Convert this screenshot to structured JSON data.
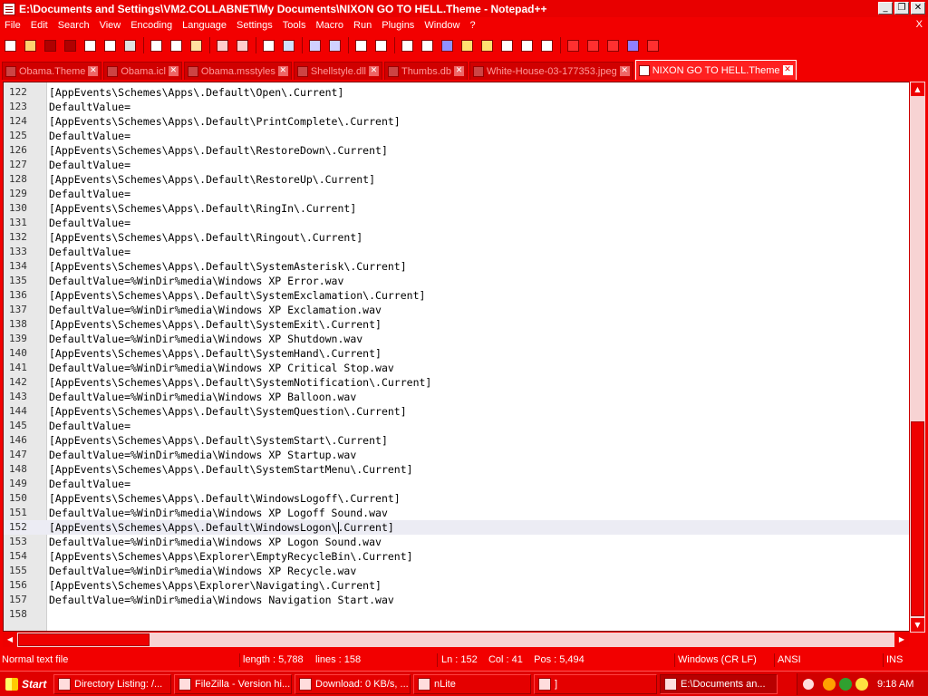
{
  "window": {
    "title": "E:\\Documents and Settings\\VM2.COLLABNET\\My Documents\\NIXON GO TO HELL.Theme - Notepad++",
    "min_glyph": "_",
    "max_glyph": "❐",
    "close_glyph": "✕"
  },
  "menu": {
    "items": [
      "File",
      "Edit",
      "Search",
      "View",
      "Encoding",
      "Language",
      "Settings",
      "Tools",
      "Macro",
      "Run",
      "Plugins",
      "Window",
      "?"
    ],
    "close_glyph": "X"
  },
  "toolbar": {
    "buttons": [
      {
        "icon": "new-file-icon",
        "color": "#ffffff"
      },
      {
        "icon": "open-file-icon",
        "color": "#ffd070"
      },
      {
        "icon": "save-icon",
        "color": "#b00000"
      },
      {
        "icon": "save-all-icon",
        "color": "#b00000"
      },
      {
        "icon": "close-file-icon",
        "color": "#ffffff"
      },
      {
        "icon": "close-all-icon",
        "color": "#ffffff"
      },
      {
        "icon": "print-icon",
        "color": "#e0e0e0"
      },
      {
        "icon": "sep",
        "color": ""
      },
      {
        "icon": "cut-icon",
        "color": "#ffffff"
      },
      {
        "icon": "copy-icon",
        "color": "#ffffff"
      },
      {
        "icon": "paste-icon",
        "color": "#ffe0a0"
      },
      {
        "icon": "sep",
        "color": ""
      },
      {
        "icon": "undo-icon",
        "color": "#ffcccc"
      },
      {
        "icon": "redo-icon",
        "color": "#ffcccc"
      },
      {
        "icon": "sep",
        "color": ""
      },
      {
        "icon": "find-icon",
        "color": "#ffffff"
      },
      {
        "icon": "replace-icon",
        "color": "#d0e0ff"
      },
      {
        "icon": "sep",
        "color": ""
      },
      {
        "icon": "zoom-in-icon",
        "color": "#d0d0ff"
      },
      {
        "icon": "zoom-out-icon",
        "color": "#d0d0ff"
      },
      {
        "icon": "sep",
        "color": ""
      },
      {
        "icon": "sync-vertical-icon",
        "color": "#ffffff"
      },
      {
        "icon": "sync-horizontal-icon",
        "color": "#ffffff"
      },
      {
        "icon": "sep",
        "color": ""
      },
      {
        "icon": "word-wrap-icon",
        "color": "#ffffff"
      },
      {
        "icon": "show-all-chars-icon",
        "color": "#ffffff"
      },
      {
        "icon": "indent-guide-icon",
        "color": "#9090ff"
      },
      {
        "icon": "user-lang-icon",
        "color": "#ffe070"
      },
      {
        "icon": "doc-map-icon",
        "color": "#ffe070"
      },
      {
        "icon": "function-list-icon",
        "color": "#ffffff"
      },
      {
        "icon": "folder-workspace-icon",
        "color": "#ffffff"
      },
      {
        "icon": "monitoring-icon",
        "color": "#ffffff"
      },
      {
        "icon": "sep",
        "color": ""
      },
      {
        "icon": "record-macro-icon",
        "color": "#ff3030"
      },
      {
        "icon": "stop-record-icon",
        "color": "#ff3030"
      },
      {
        "icon": "play-macro-icon",
        "color": "#ff3030"
      },
      {
        "icon": "run-macro-multiple-icon",
        "color": "#9080ff"
      },
      {
        "icon": "save-macro-icon",
        "color": "#ff3030"
      }
    ]
  },
  "tabs": [
    {
      "label": "Obama.Theme",
      "active": false
    },
    {
      "label": "Obama.icl",
      "active": false
    },
    {
      "label": "Obama.msstyles",
      "active": false
    },
    {
      "label": "Shellstyle.dll",
      "active": false
    },
    {
      "label": "Thumbs.db",
      "active": false
    },
    {
      "label": "White-House-03-177353.jpeg",
      "active": false
    },
    {
      "label": "NIXON GO TO HELL.Theme",
      "active": true
    }
  ],
  "tab_close_glyph": "✕",
  "editor": {
    "current_line": 152,
    "lines": [
      {
        "n": "122",
        "text": "[AppEvents\\Schemes\\Apps\\.Default\\Open\\.Current]"
      },
      {
        "n": "123",
        "text": "DefaultValue="
      },
      {
        "n": "124",
        "text": "[AppEvents\\Schemes\\Apps\\.Default\\PrintComplete\\.Current]"
      },
      {
        "n": "125",
        "text": "DefaultValue="
      },
      {
        "n": "126",
        "text": "[AppEvents\\Schemes\\Apps\\.Default\\RestoreDown\\.Current]"
      },
      {
        "n": "127",
        "text": "DefaultValue="
      },
      {
        "n": "128",
        "text": "[AppEvents\\Schemes\\Apps\\.Default\\RestoreUp\\.Current]"
      },
      {
        "n": "129",
        "text": "DefaultValue="
      },
      {
        "n": "130",
        "text": "[AppEvents\\Schemes\\Apps\\.Default\\RingIn\\.Current]"
      },
      {
        "n": "131",
        "text": "DefaultValue="
      },
      {
        "n": "132",
        "text": "[AppEvents\\Schemes\\Apps\\.Default\\Ringout\\.Current]"
      },
      {
        "n": "133",
        "text": "DefaultValue="
      },
      {
        "n": "134",
        "text": "[AppEvents\\Schemes\\Apps\\.Default\\SystemAsterisk\\.Current]"
      },
      {
        "n": "135",
        "text": "DefaultValue=%WinDir%media\\Windows XP Error.wav"
      },
      {
        "n": "136",
        "text": "[AppEvents\\Schemes\\Apps\\.Default\\SystemExclamation\\.Current]"
      },
      {
        "n": "137",
        "text": "DefaultValue=%WinDir%media\\Windows XP Exclamation.wav"
      },
      {
        "n": "138",
        "text": "[AppEvents\\Schemes\\Apps\\.Default\\SystemExit\\.Current]"
      },
      {
        "n": "139",
        "text": "DefaultValue=%WinDir%media\\Windows XP Shutdown.wav"
      },
      {
        "n": "140",
        "text": "[AppEvents\\Schemes\\Apps\\.Default\\SystemHand\\.Current]"
      },
      {
        "n": "141",
        "text": "DefaultValue=%WinDir%media\\Windows XP Critical Stop.wav"
      },
      {
        "n": "142",
        "text": "[AppEvents\\Schemes\\Apps\\.Default\\SystemNotification\\.Current]"
      },
      {
        "n": "143",
        "text": "DefaultValue=%WinDir%media\\Windows XP Balloon.wav"
      },
      {
        "n": "144",
        "text": "[AppEvents\\Schemes\\Apps\\.Default\\SystemQuestion\\.Current]"
      },
      {
        "n": "145",
        "text": "DefaultValue="
      },
      {
        "n": "146",
        "text": "[AppEvents\\Schemes\\Apps\\.Default\\SystemStart\\.Current]"
      },
      {
        "n": "147",
        "text": "DefaultValue=%WinDir%media\\Windows XP Startup.wav"
      },
      {
        "n": "148",
        "text": "[AppEvents\\Schemes\\Apps\\.Default\\SystemStartMenu\\.Current]"
      },
      {
        "n": "149",
        "text": "DefaultValue="
      },
      {
        "n": "150",
        "text": "[AppEvents\\Schemes\\Apps\\.Default\\WindowsLogoff\\.Current]"
      },
      {
        "n": "151",
        "text": "DefaultValue=%WinDir%media\\Windows XP Logoff Sound.wav"
      },
      {
        "n": "152",
        "text": "[AppEvents\\Schemes\\Apps\\.Default\\WindowsLogon\\.Current]"
      },
      {
        "n": "153",
        "text": "DefaultValue=%WinDir%media\\Windows XP Logon Sound.wav"
      },
      {
        "n": "154",
        "text": "[AppEvents\\Schemes\\Apps\\Explorer\\EmptyRecycleBin\\.Current]"
      },
      {
        "n": "155",
        "text": "DefaultValue=%WinDir%media\\Windows XP Recycle.wav"
      },
      {
        "n": "156",
        "text": "[AppEvents\\Schemes\\Apps\\Explorer\\Navigating\\.Current]"
      },
      {
        "n": "157",
        "text": "DefaultValue=%WinDir%media\\Windows Navigation Start.wav"
      },
      {
        "n": "158",
        "text": ""
      }
    ]
  },
  "scrollbar_glyphs": {
    "up": "▲",
    "down": "▼",
    "left": "◀",
    "right": "▶"
  },
  "status": {
    "file_type": "Normal text file",
    "length": "length : 5,788",
    "lines": "lines : 158",
    "position": "Ln : 152    Col : 41    Pos : 5,494",
    "eol": "Windows (CR LF)",
    "encoding": "ANSI",
    "mode": "INS"
  },
  "taskbar": {
    "start_label": "Start",
    "tasks": [
      {
        "label": "Directory Listing: /...",
        "active": false
      },
      {
        "label": "FileZilla - Version hi...",
        "active": false
      },
      {
        "label": "Download: 0 KB/s, ...",
        "active": false
      },
      {
        "label": "nLite",
        "active": false
      },
      {
        "label": "]",
        "active": false
      },
      {
        "label": "E:\\Documents an...",
        "active": true
      }
    ],
    "clock": "9:18 AM"
  },
  "colors": {
    "theme_red": "#f20000",
    "editor_bg": "#ffffff",
    "current_line_bg": "#ececf4"
  }
}
